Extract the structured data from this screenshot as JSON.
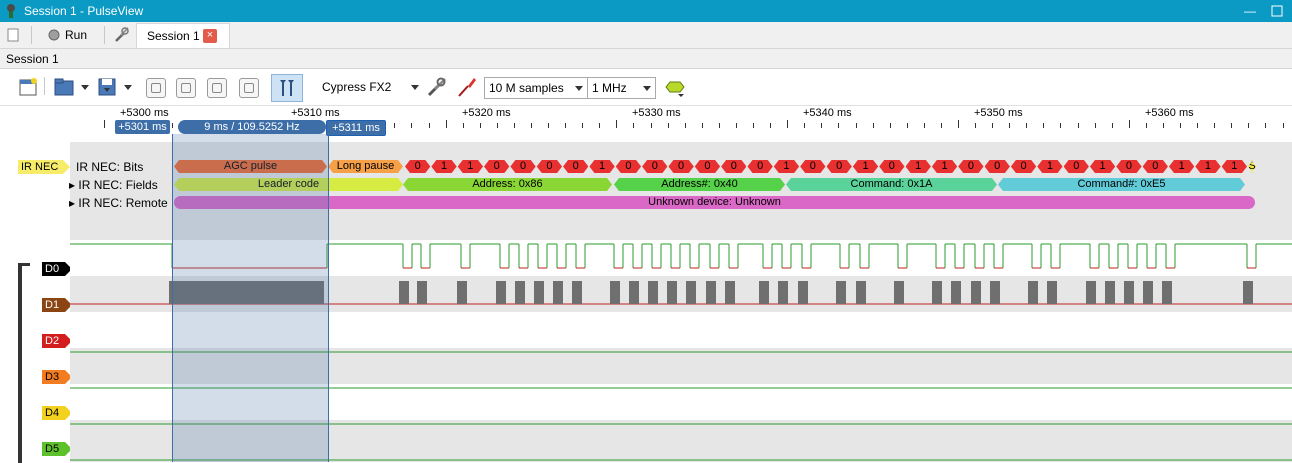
{
  "window": {
    "title": "Session 1 - PulseView",
    "minimize": "—"
  },
  "tabbar": {
    "run_label": "Run",
    "session_tab": "Session 1",
    "close_glyph": "×"
  },
  "session_label": "Session 1",
  "toolbar": {
    "device": "Cypress FX2",
    "samples": "10 M samples",
    "samplerate": "1 MHz"
  },
  "ruler": {
    "ticks": [
      "+5300 ms",
      "+5310 ms",
      "+5320 ms",
      "+5330 ms",
      "+5340 ms",
      "+5350 ms",
      "+5360 ms"
    ],
    "cursor_left": "+5301 ms",
    "cursor_mid": "9 ms / 109.5252 Hz",
    "cursor_right": "+5311 ms"
  },
  "decoder": {
    "tag": "IR NEC",
    "rows": [
      "IR NEC: Bits",
      "IR NEC: Fields",
      "IR NEC: Remote"
    ],
    "bits_agc": "AGC pulse",
    "bits_long": "Long pause",
    "bits": [
      "0",
      "1",
      "1",
      "0",
      "0",
      "0",
      "0",
      "1",
      "0",
      "0",
      "0",
      "0",
      "0",
      "0",
      "1",
      "0",
      "0",
      "1",
      "0",
      "1",
      "1",
      "0",
      "0",
      "0",
      "1",
      "0",
      "1",
      "0",
      "0",
      "1",
      "1",
      "1"
    ],
    "bits_end": "S",
    "fields": [
      "Leader code",
      "Address: 0x86",
      "Address#: 0x40",
      "Command: 0x1A",
      "Command#: 0xE5"
    ],
    "remote": "Unknown device: Unknown"
  },
  "channels": [
    {
      "label": "D0",
      "color": "#000000",
      "text_color": "#ffffff"
    },
    {
      "label": "D1",
      "color": "#8b4513",
      "text_color": "#ffffff"
    },
    {
      "label": "D2",
      "color": "#d21e1e",
      "text_color": "#ffffff"
    },
    {
      "label": "D3",
      "color": "#f47c20",
      "text_color": "#000000"
    },
    {
      "label": "D4",
      "color": "#f2d21f",
      "text_color": "#000000"
    },
    {
      "label": "D5",
      "color": "#5dc12c",
      "text_color": "#000000"
    }
  ],
  "colors": {
    "titlebar": "#0a9ac4",
    "agc": "#f26a2e",
    "long_pause": "#f6a048",
    "bit": "#e83030",
    "leader": "#d6ec42",
    "address": "#8ad635",
    "address_inv": "#56d14a",
    "command": "#5ad39a",
    "command_inv": "#61ccd8",
    "remote": "#da68c6"
  }
}
